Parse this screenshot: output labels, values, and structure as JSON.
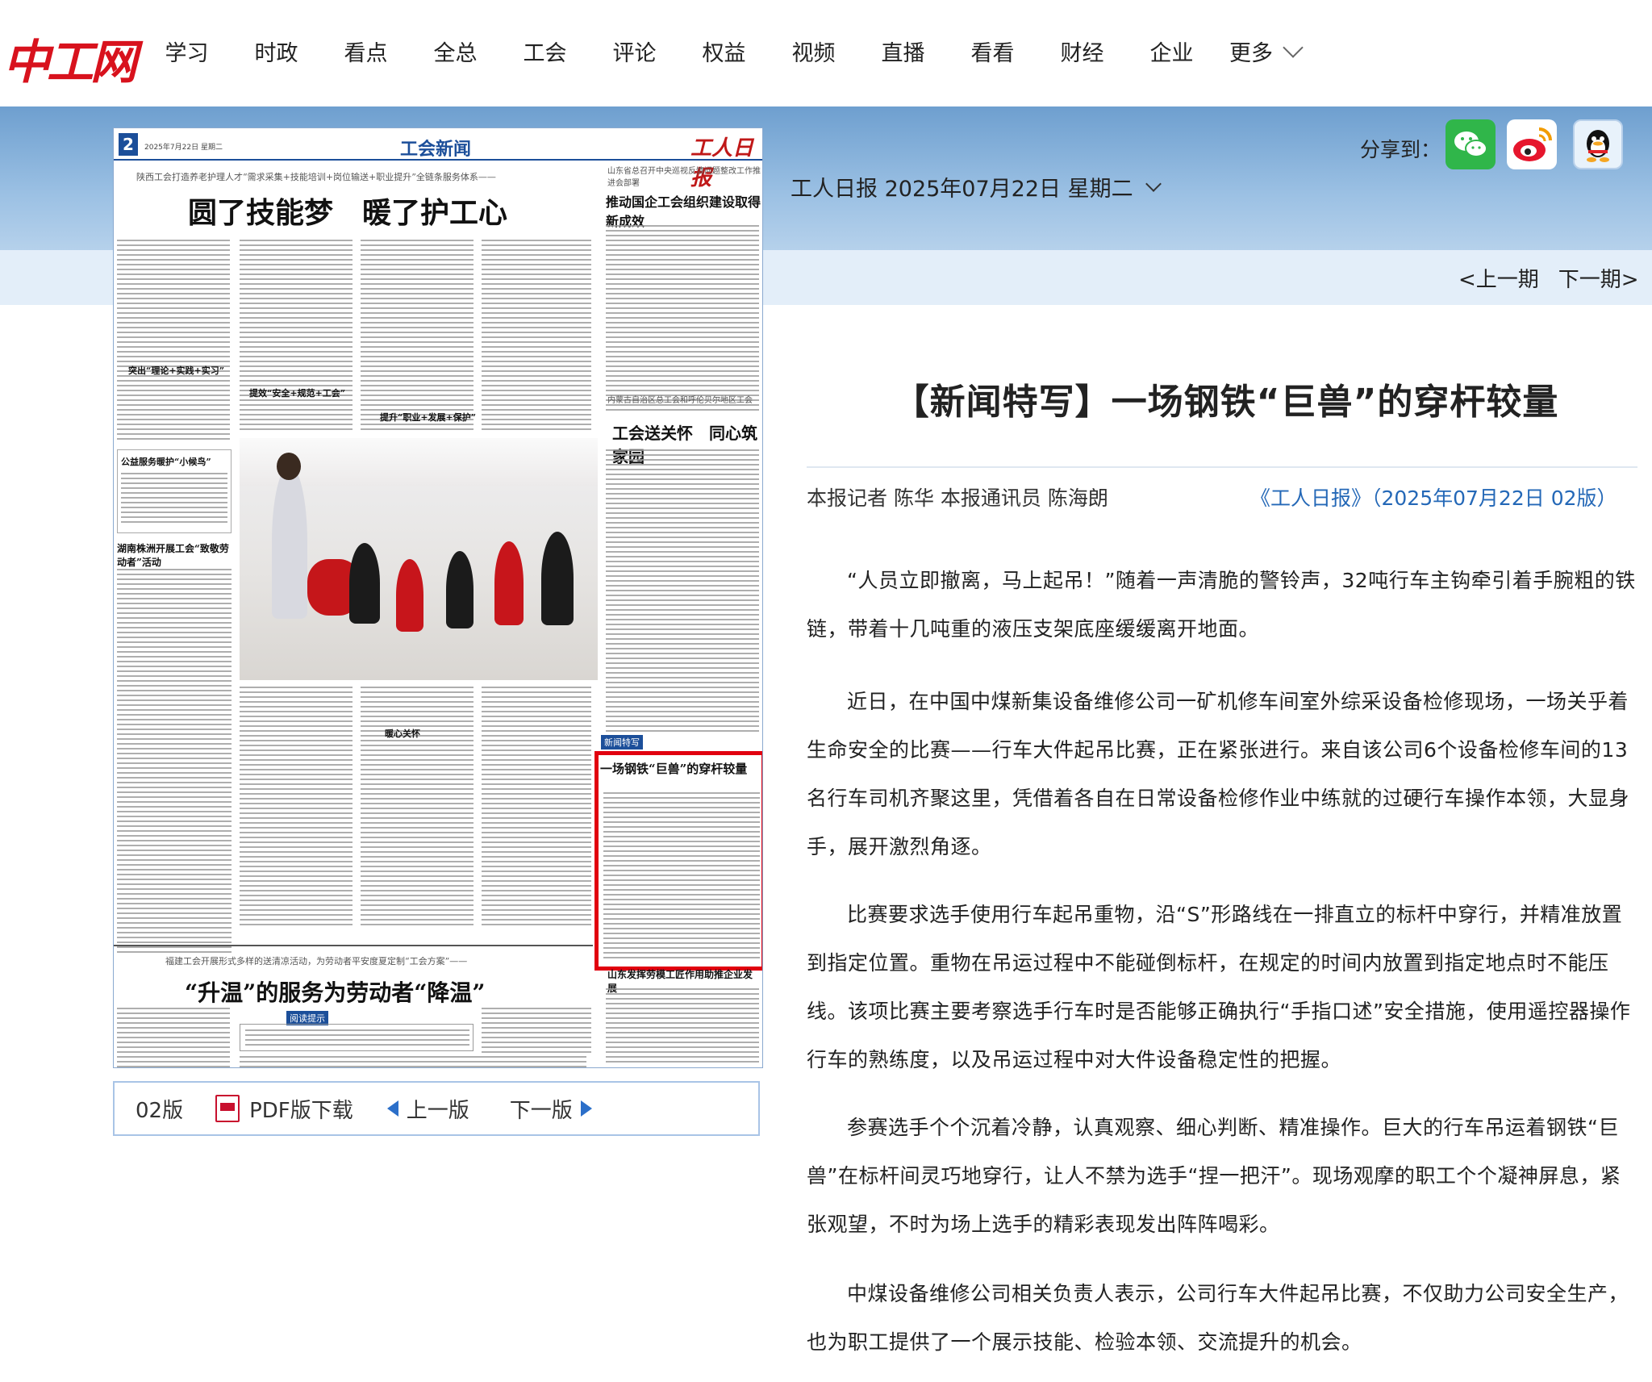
{
  "site": {
    "logo": "中工网",
    "nav": [
      "学习",
      "时政",
      "看点",
      "全总",
      "工会",
      "评论",
      "权益",
      "视频",
      "直播",
      "看看",
      "财经",
      "企业"
    ],
    "nav_more": "更多"
  },
  "share": {
    "label": "分享到：",
    "icons": [
      "wechat-icon",
      "weibo-icon",
      "qq-icon"
    ]
  },
  "issue": {
    "date": "工人日报 2025年07月22日 星期二",
    "prev": "<上一期",
    "next": "下一期>"
  },
  "newspaper": {
    "page_no": "2",
    "date_line": "2025年7月22日 星期二",
    "section": "工会新闻",
    "brand": "工人日报",
    "kicker1": "陕西工会打造养老护理人才“需求采集+技能培训+岗位输送+职业提升”全链条服务体系——",
    "headline1": "圆了技能梦　暖了护工心",
    "side_kicker1": "山东省总召开中央巡视反馈问题整改工作推进会部署",
    "side_headline1": "推动国企工会组织建设取得新成效",
    "side_kicker2": "内蒙古自治区总工会和呼伦贝尔地区工会",
    "side_headline2": "工会送关怀　同心筑家园",
    "sub1": "突出“理论+实践+实习”",
    "sub2": "提效“安全+规范+工会”",
    "sub3": "提升“职业+发展+保护”",
    "box1": "公益服务暖护“小候鸟”",
    "box2": "湖南株洲开展工会“致敬劳动者”活动",
    "sub4": "暖心关怀",
    "special_label": "新闻特写",
    "special_headline": "一场钢铁“巨兽”的穿杆较量",
    "kicker2": "福建工会开展形式多样的送清凉活动，为劳动者平安度夏定制“工会方案”——",
    "headline2": "“升温”的服务为劳动者“降温”",
    "box3": "阅读提示",
    "side_headline3": "山东发挥劳模工匠作用助推企业发展"
  },
  "pager": {
    "edition": "02版",
    "pdf": "PDF版下载",
    "prev": "上一版",
    "next": "下一版"
  },
  "article": {
    "title": "【新闻特写】一场钢铁“巨兽”的穿杆较量",
    "byline": "本报记者 陈华 本报通讯员 陈海朗",
    "source": "《工人日报》（2025年07月22日 02版）",
    "paragraphs": [
      "“人员立即撤离，马上起吊！”随着一声清脆的警铃声，32吨行车主钩牵引着手腕粗的铁链，带着十几吨重的液压支架底座缓缓离开地面。",
      "近日，在中国中煤新集设备维修公司一矿机修车间室外综采设备检修现场，一场关乎着生命安全的比赛——行车大件起吊比赛，正在紧张进行。来自该公司6个设备检修车间的13名行车司机齐聚这里，凭借着各自在日常设备检修作业中练就的过硬行车操作本领，大显身手，展开激烈角逐。",
      "比赛要求选手使用行车起吊重物，沿“S”形路线在一排直立的标杆中穿行，并精准放置到指定位置。重物在吊运过程中不能碰倒标杆，在规定的时间内放置到指定地点时不能压线。该项比赛主要考察选手行车时是否能够正确执行“手指口述”安全措施，使用遥控器操作行车的熟练度，以及吊运过程中对大件设备稳定性的把握。",
      "参赛选手个个沉着冷静，认真观察、细心判断、精准操作。巨大的行车吊运着钢铁“巨兽”在标杆间灵巧地穿行，让人不禁为选手“捏一把汗”。现场观摩的职工个个凝神屏息，紧张观望，不时为场上选手的精彩表现发出阵阵喝彩。",
      "中煤设备维修公司相关负责人表示，公司行车大件起吊比赛，不仅助力公司安全生产，也为职工提供了一个展示技能、检验本领、交流提升的机会。"
    ]
  },
  "colors": {
    "brand_red": "#d8121d",
    "link_blue": "#2468b7",
    "band_blue": "#6e9fcf",
    "highlight_red": "#e1000f"
  }
}
